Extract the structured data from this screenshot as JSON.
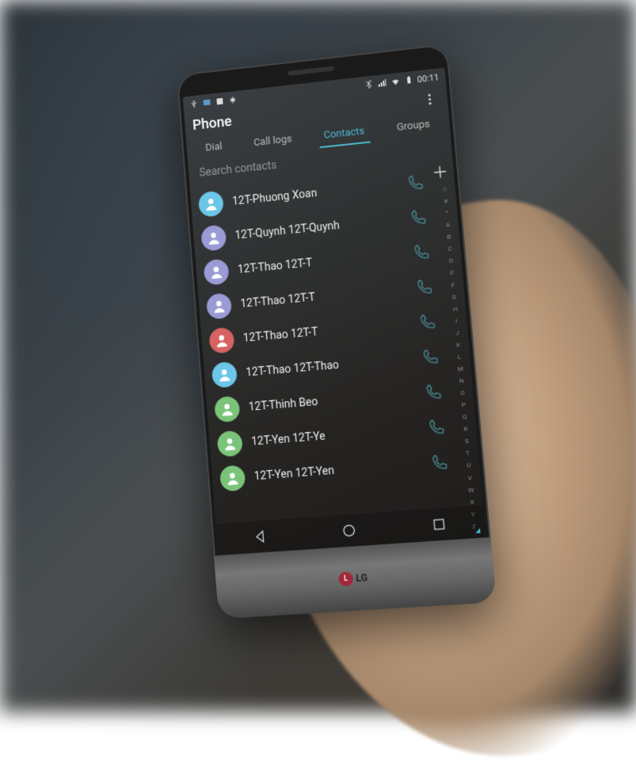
{
  "statusbar": {
    "time": "00:11"
  },
  "header": {
    "title": "Phone"
  },
  "tabs": {
    "items": [
      {
        "label": "Dial",
        "active": false
      },
      {
        "label": "Call logs",
        "active": false
      },
      {
        "label": "Contacts",
        "active": true
      },
      {
        "label": "Groups",
        "active": false
      }
    ]
  },
  "search": {
    "placeholder": "Search contacts"
  },
  "contacts": [
    {
      "name": "12T-Phuong Xoan",
      "color": "#6bc6e8"
    },
    {
      "name": "12T-Quynh 12T-Quynh",
      "color": "#9a9ad4"
    },
    {
      "name": "12T-Thao 12T-T",
      "color": "#9a9ad4"
    },
    {
      "name": "12T-Thao 12T-T",
      "color": "#9a9ad4"
    },
    {
      "name": "12T-Thao 12T-T",
      "color": "#d66262"
    },
    {
      "name": "12T-Thao 12T-Thao",
      "color": "#6bc6e8"
    },
    {
      "name": "12T-Thinh Beo",
      "color": "#7ac47a"
    },
    {
      "name": "12T-Yen 12T-Ye",
      "color": "#7ac47a"
    },
    {
      "name": "12T-Yen 12T-Yen",
      "color": "#7ac47a"
    }
  ],
  "index": [
    "☆",
    "#",
    "^",
    "A",
    "B",
    "C",
    "D",
    "E",
    "F",
    "G",
    "H",
    "I",
    "J",
    "K",
    "L",
    "M",
    "N",
    "O",
    "P",
    "Q",
    "R",
    "S",
    "T",
    "U",
    "V",
    "W",
    "X",
    "Y",
    "Z"
  ],
  "logo": "LG"
}
